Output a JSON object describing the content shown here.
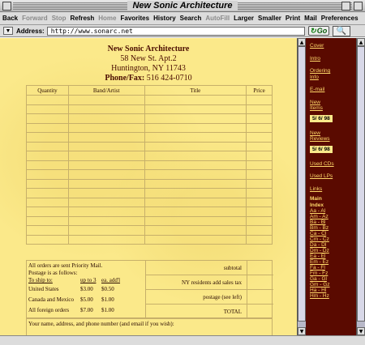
{
  "window": {
    "title": "New Sonic Architecture"
  },
  "toolbar": {
    "back": "Back",
    "forward": "Forward",
    "stop": "Stop",
    "refresh": "Refresh",
    "home": "Home",
    "favorites": "Favorites",
    "history": "History",
    "search": "Search",
    "autofill": "AutoFill",
    "larger": "Larger",
    "smaller": "Smaller",
    "print": "Print",
    "mail": "Mail",
    "preferences": "Preferences"
  },
  "address": {
    "label": "Address:",
    "url": "http://www.sonarc.net",
    "go": "Go"
  },
  "header": {
    "name": "New Sonic Architecture",
    "street": "58 New St. Apt.2",
    "city": "Huntington, NY 11743",
    "phone_label": "Phone/Fax:",
    "phone": "516 424-0710"
  },
  "order_table": {
    "columns": [
      "Quantity",
      "Band/Artist",
      "Title",
      "Price"
    ],
    "empty_rows": 16
  },
  "shipping": {
    "line1": "All orders are sent Priority Mail.",
    "line2": "Postage is as follows:",
    "head": [
      "To ship to:",
      "up to 3",
      "ea. add'l"
    ],
    "rows": [
      [
        "United States",
        "$3.00",
        "$0.50"
      ],
      [
        "Canada and Mexico",
        "$5.00",
        "$1.00"
      ],
      [
        "All foreign orders",
        "$7.00",
        "$1.00"
      ]
    ]
  },
  "totals": {
    "subtotal": "subtotal",
    "tax": "NY residents add sales tax",
    "postage": "postage (see left)",
    "total": "TOTAL"
  },
  "note": "Your name, address, and phone number (and email if you wish):",
  "nav": {
    "links": [
      "Cover",
      "Intro",
      "Ordering Info",
      "E-mail",
      "New Items"
    ],
    "new_items_date": "5/ 6/ 98",
    "new_reviews": "New Reviews",
    "new_reviews_date": "5/ 6/ 98",
    "links2": [
      "Used CDs",
      "Used LPs",
      "Links"
    ],
    "main_index": "Main Index",
    "index": [
      "Aa - Al",
      "Am - Az",
      "Ba - Bl",
      "Bm - Bz",
      "Ca - Cl",
      "Cm - Cz",
      "Da - Dl",
      "Dm - Dz",
      "Ea - El",
      "Em - Ez",
      "Fa - Fl",
      "Fm - Fz",
      "Ga - Gl",
      "Gm - Gz",
      "Ha - Hl",
      "Hm - Hz"
    ]
  }
}
